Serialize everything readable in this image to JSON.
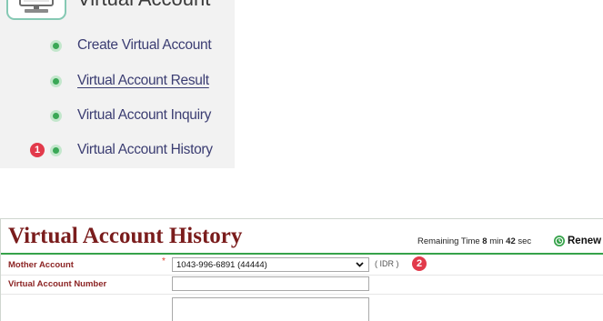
{
  "sidebar": {
    "title": "Virtual Account",
    "title_icon": "monitor-icon",
    "items": [
      {
        "label": "Create Virtual Account",
        "bullet_icon": "radio-bullet-icon"
      },
      {
        "label": "Virtual Account Result",
        "bullet_icon": "radio-bullet-icon"
      },
      {
        "label": "Virtual Account Inquiry",
        "bullet_icon": "radio-bullet-icon"
      },
      {
        "label": "Virtual Account History",
        "bullet_icon": "radio-bullet-icon"
      }
    ]
  },
  "callouts": [
    "1",
    "2"
  ],
  "panel": {
    "title": "Virtual Account History",
    "timer": {
      "label": "Remaining Time",
      "minutes": "8",
      "minutes_unit": "min",
      "seconds": "42",
      "seconds_unit": "sec"
    },
    "renew": {
      "label": "Renew",
      "icon": "clock-icon"
    },
    "form": {
      "mother_account": {
        "label": "Mother Account",
        "required_mark": "*",
        "value": "1043-996-6891 (44444)",
        "currency": "( IDR )"
      },
      "virtual_account_number": {
        "label": "Virtual Account Number",
        "value": ""
      }
    }
  },
  "colors": {
    "title": "#7a1c1c",
    "label": "#8c2424",
    "accent_green": "#36a24a",
    "bullet_green": "#3aa856",
    "callout": "#e23a4b",
    "menu_text": "#3b3d72",
    "required": "#e0402a"
  }
}
